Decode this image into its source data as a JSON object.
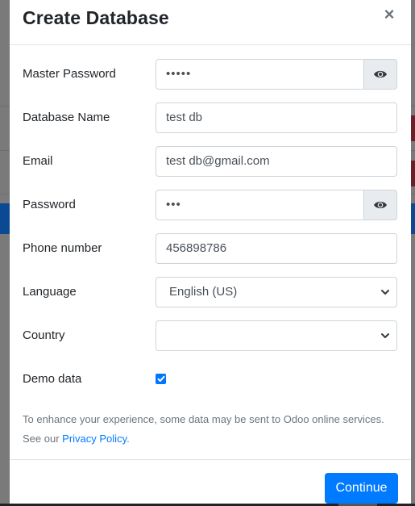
{
  "dialog": {
    "title": "Create Database",
    "close_label": "×"
  },
  "form": {
    "master_password": {
      "label": "Master Password",
      "value": "•••••",
      "toggle_icon": "eye-icon"
    },
    "database_name": {
      "label": "Database Name",
      "value": "test db"
    },
    "email": {
      "label": "Email",
      "value": "test db@gmail.com"
    },
    "password": {
      "label": "Password",
      "value": "•••",
      "toggle_icon": "eye-icon"
    },
    "phone": {
      "label": "Phone number",
      "value": "456898786"
    },
    "language": {
      "label": "Language",
      "selected": "English (US)"
    },
    "country": {
      "label": "Country",
      "selected": ""
    },
    "demo_data": {
      "label": "Demo data",
      "checked": true
    }
  },
  "notice": {
    "text_before": "To enhance your experience, some data may be sent to Odoo online services. See our ",
    "link_text": "Privacy Policy",
    "text_after": "."
  },
  "footer": {
    "continue_label": "Continue"
  },
  "colors": {
    "primary": "#007bff",
    "checkbox": "#0075ff",
    "backdrop": "#7a7a7a",
    "backdrop_red": "#6b1f28",
    "backdrop_blue": "#0b4a93"
  }
}
